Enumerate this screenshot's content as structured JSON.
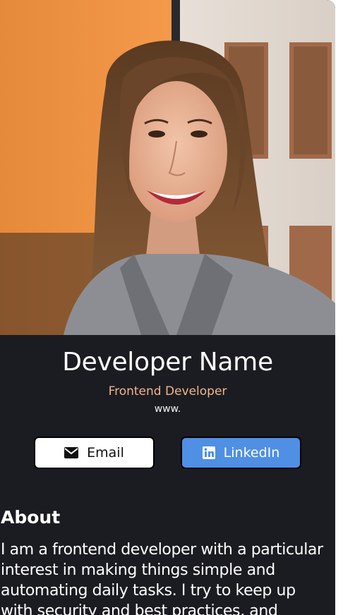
{
  "profile": {
    "photo_alt": "Profile photo",
    "name": "Developer Name",
    "role": "Frontend Developer",
    "website": "www."
  },
  "actions": {
    "email_label": "Email",
    "linkedin_label": "LinkedIn",
    "email_icon": "envelope-icon",
    "linkedin_icon": "linkedin-icon"
  },
  "about": {
    "title": "About",
    "text": "I am a frontend developer with a particular interest in making things simple and automating daily tasks. I try to keep up with security and best practices, and"
  },
  "colors": {
    "background": "#1b1c21",
    "accent_role": "#f3b48d",
    "linkedin_button": "#4f8fe4",
    "email_button": "#ffffff"
  }
}
